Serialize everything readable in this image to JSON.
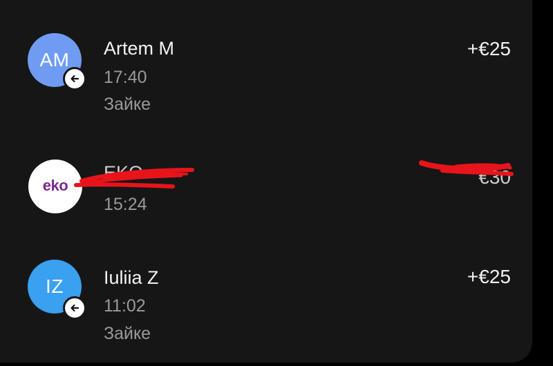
{
  "transactions": [
    {
      "initials": "AM",
      "name": "Artem M",
      "time": "17:40",
      "note": "Зайке",
      "amount": "+€25",
      "avatar_color": "#6f9cf2",
      "badge_icon": "arrow-left-icon"
    },
    {
      "logo_text": "eko",
      "name": "EKO",
      "time": "15:24",
      "amount": "€30",
      "logo_color": "#7b2a8e",
      "redacted": true
    },
    {
      "initials": "IZ",
      "name": "Iuliia Z",
      "time": "11:02",
      "note": "Зайке",
      "amount": "+€25",
      "avatar_color": "#3aa0f0",
      "badge_icon": "arrow-left-icon"
    }
  ],
  "redaction_color": "#e8141b"
}
